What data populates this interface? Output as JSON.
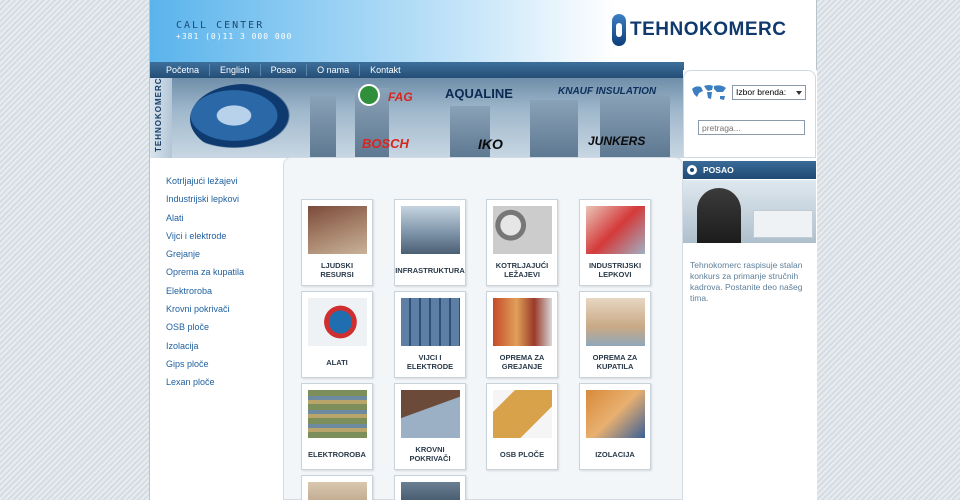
{
  "header": {
    "call_center_title": "CALL CENTER",
    "call_center_phone": "+381 (0)11 3 000 000",
    "logo_text": "TEHNOKOMERC"
  },
  "nav": {
    "items": [
      "Početna",
      "English",
      "Posao",
      "O nama",
      "Kontakt"
    ]
  },
  "banner": {
    "side_text": "TEHNOKOMERC",
    "brands": [
      "FAG",
      "AQUALINE",
      "KNAUF INSULATION",
      "BOSCH",
      "IKO",
      "JUNKERS"
    ]
  },
  "left_menu": {
    "items": [
      "Kotrljajući ležajevi",
      "Industrijski lepkovi",
      "Alati",
      "Vijci i elektrode",
      "Grejanje",
      "Oprema za kupatila",
      "Elektroroba",
      "Krovni pokrivači",
      "OSB ploče",
      "Izolacija",
      "Gips ploče",
      "Lexan ploče"
    ]
  },
  "tiles": [
    {
      "label": "LJUDSKI RESURSI",
      "icon": "people-meeting-image"
    },
    {
      "label": "INFRASTRUKTURA",
      "icon": "building-image"
    },
    {
      "label": "KOTRLJAJUĆI LEŽAJEVI",
      "icon": "bearings-image"
    },
    {
      "label": "INDUSTRIJSKI LEPKOVI",
      "icon": "glue-image"
    },
    {
      "label": "ALATI",
      "icon": "drill-image"
    },
    {
      "label": "VIJCI I ELEKTRODE",
      "icon": "screws-image"
    },
    {
      "label": "OPREMA ZA GREJANJE",
      "icon": "heating-image"
    },
    {
      "label": "OPREMA ZA KUPATILA",
      "icon": "bathroom-image"
    },
    {
      "label": "ELEKTROROBA",
      "icon": "electrical-image"
    },
    {
      "label": "KROVNI POKRIVAČI",
      "icon": "roof-image"
    },
    {
      "label": "OSB PLOČE",
      "icon": "osb-image"
    },
    {
      "label": "IZOLACIJA",
      "icon": "insulation-image"
    },
    {
      "label": "",
      "icon": "gips-image"
    },
    {
      "label": "",
      "icon": "lexan-image"
    }
  ],
  "right": {
    "brand_select_value": "Izbor brenda:",
    "search_placeholder": "pretraga...",
    "posao_title": "POSAO",
    "posao_text": "Tehnokomerc raspisuje stalan konkurs za primanje stručnih kadrova. Postanite deo našeg tima."
  },
  "colors": {
    "nav_bg": "#2d5b86",
    "link": "#1e5f9f",
    "logo": "#103a6d",
    "posao_text": "#5e7f9a"
  }
}
